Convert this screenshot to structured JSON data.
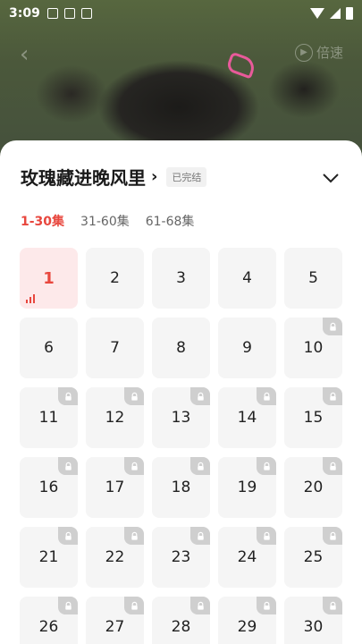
{
  "status_bar": {
    "time": "3:09"
  },
  "video": {
    "speed_label": "倍速"
  },
  "drama": {
    "title": "玫瑰藏进晚风里",
    "badge": "已完结"
  },
  "tabs": [
    {
      "label": "1-30集",
      "active": true
    },
    {
      "label": "31-60集",
      "active": false
    },
    {
      "label": "61-68集",
      "active": false
    }
  ],
  "episodes": [
    {
      "num": "1",
      "locked": false,
      "playing": true
    },
    {
      "num": "2",
      "locked": false
    },
    {
      "num": "3",
      "locked": false
    },
    {
      "num": "4",
      "locked": false
    },
    {
      "num": "5",
      "locked": false
    },
    {
      "num": "6",
      "locked": false
    },
    {
      "num": "7",
      "locked": false
    },
    {
      "num": "8",
      "locked": false
    },
    {
      "num": "9",
      "locked": false
    },
    {
      "num": "10",
      "locked": true
    },
    {
      "num": "11",
      "locked": true
    },
    {
      "num": "12",
      "locked": true
    },
    {
      "num": "13",
      "locked": true
    },
    {
      "num": "14",
      "locked": true
    },
    {
      "num": "15",
      "locked": true
    },
    {
      "num": "16",
      "locked": true
    },
    {
      "num": "17",
      "locked": true
    },
    {
      "num": "18",
      "locked": true
    },
    {
      "num": "19",
      "locked": true
    },
    {
      "num": "20",
      "locked": true
    },
    {
      "num": "21",
      "locked": true
    },
    {
      "num": "22",
      "locked": true
    },
    {
      "num": "23",
      "locked": true
    },
    {
      "num": "24",
      "locked": true
    },
    {
      "num": "25",
      "locked": true
    },
    {
      "num": "26",
      "locked": true
    },
    {
      "num": "27",
      "locked": true
    },
    {
      "num": "28",
      "locked": true
    },
    {
      "num": "29",
      "locked": true
    },
    {
      "num": "30",
      "locked": true
    }
  ],
  "colors": {
    "accent": "#e8473e",
    "active_cell_bg": "#fde9ea",
    "cell_bg": "#f5f5f5"
  }
}
